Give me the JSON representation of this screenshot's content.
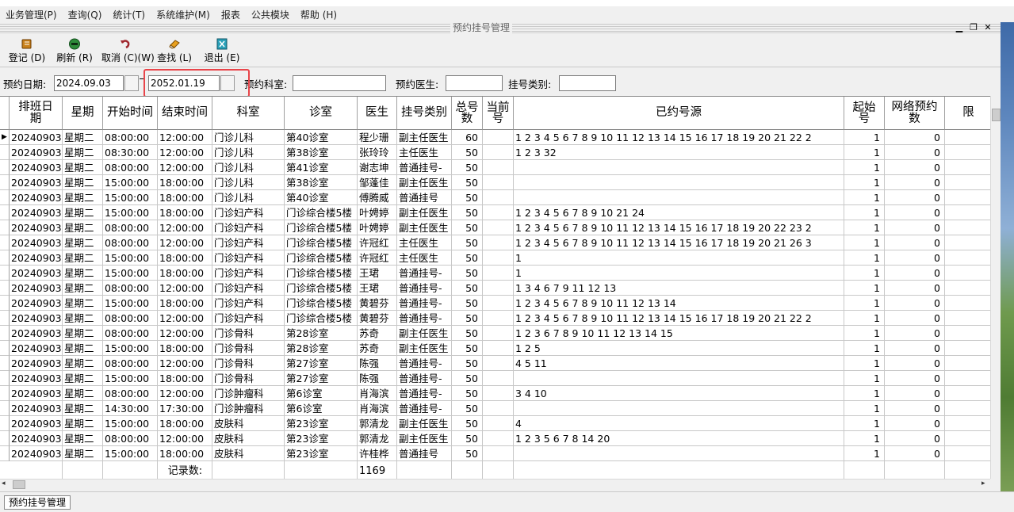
{
  "menu": [
    "业务管理(P)",
    "查询(Q)",
    "统计(T)",
    "系统维护(M)",
    "报表",
    "公共模块",
    "帮助 (H)"
  ],
  "child_window": {
    "title": "预约挂号管理",
    "min": "▁",
    "restore": "❐",
    "close": "✕"
  },
  "toolbar": [
    {
      "label": "登记 (D)",
      "icon": "book-icon",
      "color": "#c8801a"
    },
    {
      "label": "刷新 (R)",
      "icon": "refresh-icon",
      "color": "#2e8b3a"
    },
    {
      "label": "取消 (C)(W)",
      "icon": "undo-icon",
      "color": "#a0282e"
    },
    {
      "label": "查找 (L)",
      "icon": "eraser-icon",
      "color": "#e8a01e"
    },
    {
      "label": "退出 (E)",
      "icon": "exit-icon",
      "color": "#2aa0b8"
    }
  ],
  "filters": {
    "date_label": "预约日期:",
    "date_from": "2024.09.03",
    "date_to": "2052.01.19",
    "dept_label": "预约科室:",
    "dept_value": "",
    "doctor_label": "预约医生:",
    "doctor_value": "",
    "type_label": "挂号类别:",
    "type_value": ""
  },
  "table": {
    "columns": [
      "排班日期",
      "星期",
      "开始时间",
      "结束时间",
      "科室",
      "诊室",
      "医生",
      "挂号类别",
      "总号数",
      "当前号",
      "已约号源",
      "起始号",
      "网络预约数",
      "限"
    ],
    "rows": [
      [
        "20240903",
        "星期二",
        "08:00:00",
        "12:00:00",
        "门诊儿科",
        "第40诊室",
        "程少珊",
        "副主任医生",
        "60",
        "",
        "1 2 3 4 5 6 7 8 9 10 11 12 13 14 15 16 17 18 19 20 21 22 2",
        "1",
        "0"
      ],
      [
        "20240903",
        "星期二",
        "08:30:00",
        "12:00:00",
        "门诊儿科",
        "第38诊室",
        "张玲玲",
        "主任医生",
        "50",
        "",
        "1 2 3 32",
        "1",
        "0"
      ],
      [
        "20240903",
        "星期二",
        "08:00:00",
        "12:00:00",
        "门诊儿科",
        "第41诊室",
        "谢志坤",
        "普通挂号-",
        "50",
        "",
        "",
        "1",
        "0"
      ],
      [
        "20240903",
        "星期二",
        "15:00:00",
        "18:00:00",
        "门诊儿科",
        "第38诊室",
        "邹蓬佳",
        "副主任医生",
        "50",
        "",
        "",
        "1",
        "0"
      ],
      [
        "20240903",
        "星期二",
        "15:00:00",
        "18:00:00",
        "门诊儿科",
        "第40诊室",
        "傅腾威",
        "普通挂号",
        "50",
        "",
        "",
        "1",
        "0"
      ],
      [
        "20240903",
        "星期二",
        "15:00:00",
        "18:00:00",
        "门诊妇产科",
        "门诊综合楼5楼",
        "叶娉婷",
        "副主任医生",
        "50",
        "",
        "1 2 3 4 5 6 7 8 9 10 21 24",
        "1",
        "0"
      ],
      [
        "20240903",
        "星期二",
        "08:00:00",
        "12:00:00",
        "门诊妇产科",
        "门诊综合楼5楼",
        "叶娉婷",
        "副主任医生",
        "50",
        "",
        "1 2 3 4 5 6 7 8 9 10 11 12 13 14 15 16 17 18 19 20 22 23 2",
        "1",
        "0"
      ],
      [
        "20240903",
        "星期二",
        "08:00:00",
        "12:00:00",
        "门诊妇产科",
        "门诊综合楼5楼",
        "许冠红",
        "主任医生",
        "50",
        "",
        "1 2 3 4 5 6 7 8 9 10 11 12 13 14 15 16 17 18 19 20 21 26 3",
        "1",
        "0"
      ],
      [
        "20240903",
        "星期二",
        "15:00:00",
        "18:00:00",
        "门诊妇产科",
        "门诊综合楼5楼",
        "许冠红",
        "主任医生",
        "50",
        "",
        "1",
        "1",
        "0"
      ],
      [
        "20240903",
        "星期二",
        "15:00:00",
        "18:00:00",
        "门诊妇产科",
        "门诊综合楼5楼",
        "王珺",
        "普通挂号-",
        "50",
        "",
        "1",
        "1",
        "0"
      ],
      [
        "20240903",
        "星期二",
        "08:00:00",
        "12:00:00",
        "门诊妇产科",
        "门诊综合楼5楼",
        "王珺",
        "普通挂号-",
        "50",
        "",
        "1 3 4 6 7 9 11 12 13",
        "1",
        "0"
      ],
      [
        "20240903",
        "星期二",
        "15:00:00",
        "18:00:00",
        "门诊妇产科",
        "门诊综合楼5楼",
        "黄碧芬",
        "普通挂号-",
        "50",
        "",
        "1 2 3 4 5 6 7 8 9 10 11 12 13 14",
        "1",
        "0"
      ],
      [
        "20240903",
        "星期二",
        "08:00:00",
        "12:00:00",
        "门诊妇产科",
        "门诊综合楼5楼",
        "黄碧芬",
        "普通挂号-",
        "50",
        "",
        "1 2 3 4 5 6 7 8 9 10 11 12 13 14 15 16 17 18 19 20 21 22 2",
        "1",
        "0"
      ],
      [
        "20240903",
        "星期二",
        "08:00:00",
        "12:00:00",
        "门诊骨科",
        "第28诊室",
        "苏奇",
        "副主任医生",
        "50",
        "",
        "1 2 3 6 7 8 9 10 11 12 13 14 15",
        "1",
        "0"
      ],
      [
        "20240903",
        "星期二",
        "15:00:00",
        "18:00:00",
        "门诊骨科",
        "第28诊室",
        "苏奇",
        "副主任医生",
        "50",
        "",
        "1 2 5",
        "1",
        "0"
      ],
      [
        "20240903",
        "星期二",
        "08:00:00",
        "12:00:00",
        "门诊骨科",
        "第27诊室",
        "陈强",
        "普通挂号-",
        "50",
        "",
        "4 5 11",
        "1",
        "0"
      ],
      [
        "20240903",
        "星期二",
        "15:00:00",
        "18:00:00",
        "门诊骨科",
        "第27诊室",
        "陈强",
        "普通挂号-",
        "50",
        "",
        "",
        "1",
        "0"
      ],
      [
        "20240903",
        "星期二",
        "08:00:00",
        "12:00:00",
        "门诊肿瘤科",
        "第6诊室",
        "肖海滨",
        "普通挂号-",
        "50",
        "",
        "3 4 10",
        "1",
        "0"
      ],
      [
        "20240903",
        "星期二",
        "14:30:00",
        "17:30:00",
        "门诊肿瘤科",
        "第6诊室",
        "肖海滨",
        "普通挂号-",
        "50",
        "",
        "",
        "1",
        "0"
      ],
      [
        "20240903",
        "星期二",
        "15:00:00",
        "18:00:00",
        "皮肤科",
        "第23诊室",
        "郭清龙",
        "副主任医生",
        "50",
        "",
        "4",
        "1",
        "0"
      ],
      [
        "20240903",
        "星期二",
        "08:00:00",
        "12:00:00",
        "皮肤科",
        "第23诊室",
        "郭清龙",
        "副主任医生",
        "50",
        "",
        "1 2 3 5 6 7 8 14 20",
        "1",
        "0"
      ],
      [
        "20240903",
        "星期二",
        "15:00:00",
        "18:00:00",
        "皮肤科",
        "第23诊室",
        "许桂桦",
        "普通挂号",
        "50",
        "",
        "",
        "1",
        "0"
      ]
    ],
    "footer_label": "记录数:",
    "footer_count": "1169"
  },
  "statusbar": {
    "tab": "预约挂号管理"
  },
  "colors": {
    "highlight": "#e8454a",
    "grid_line": "#c8c8c8"
  }
}
